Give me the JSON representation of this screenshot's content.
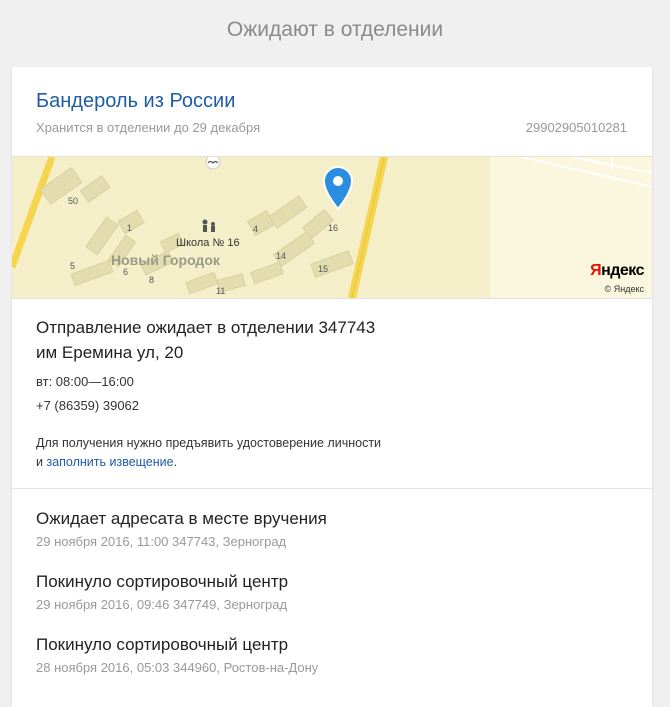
{
  "page": {
    "title": "Ожидают в отделении"
  },
  "parcel": {
    "title": "Бандероль из России",
    "storage_note": "Хранится в отделении до 29 декабря",
    "tracking_number": "29902905010281"
  },
  "map": {
    "district_label": "Новый Городок",
    "school_label": "Школа № 16",
    "house_numbers": [
      "50",
      "1",
      "4",
      "16",
      "5",
      "6",
      "8",
      "14",
      "15",
      "11"
    ],
    "logo_first": "Я",
    "logo_rest": "ндекс",
    "copyright": "© Яндекс",
    "colors": {
      "background": "#f4efc8",
      "road": "#f5d44e",
      "building": "#e3dcae",
      "pin": "#2a8de0",
      "yandex_red": "#e61400"
    }
  },
  "office": {
    "line1": "Отправление ожидает в отделении 347743",
    "line2": "им Еремина ул, 20",
    "hours": "вт: 08:00—16:00",
    "phone": "+7 (86359) 39062",
    "notice_text": "Для получения нужно предъявить удостоверение личности",
    "notice_and": "и",
    "notice_link": "заполнить извещение",
    "notice_period": "."
  },
  "history": [
    {
      "title": "Ожидает адресата в месте вручения",
      "meta": "29 ноября 2016, 11:00 347743, Зерноград"
    },
    {
      "title": "Покинуло сортировочный центр",
      "meta": "29 ноября 2016, 09:46 347749, Зерноград"
    },
    {
      "title": "Покинуло сортировочный центр",
      "meta": "28 ноября 2016, 05:03 344960, Ростов-на-Дону"
    }
  ]
}
